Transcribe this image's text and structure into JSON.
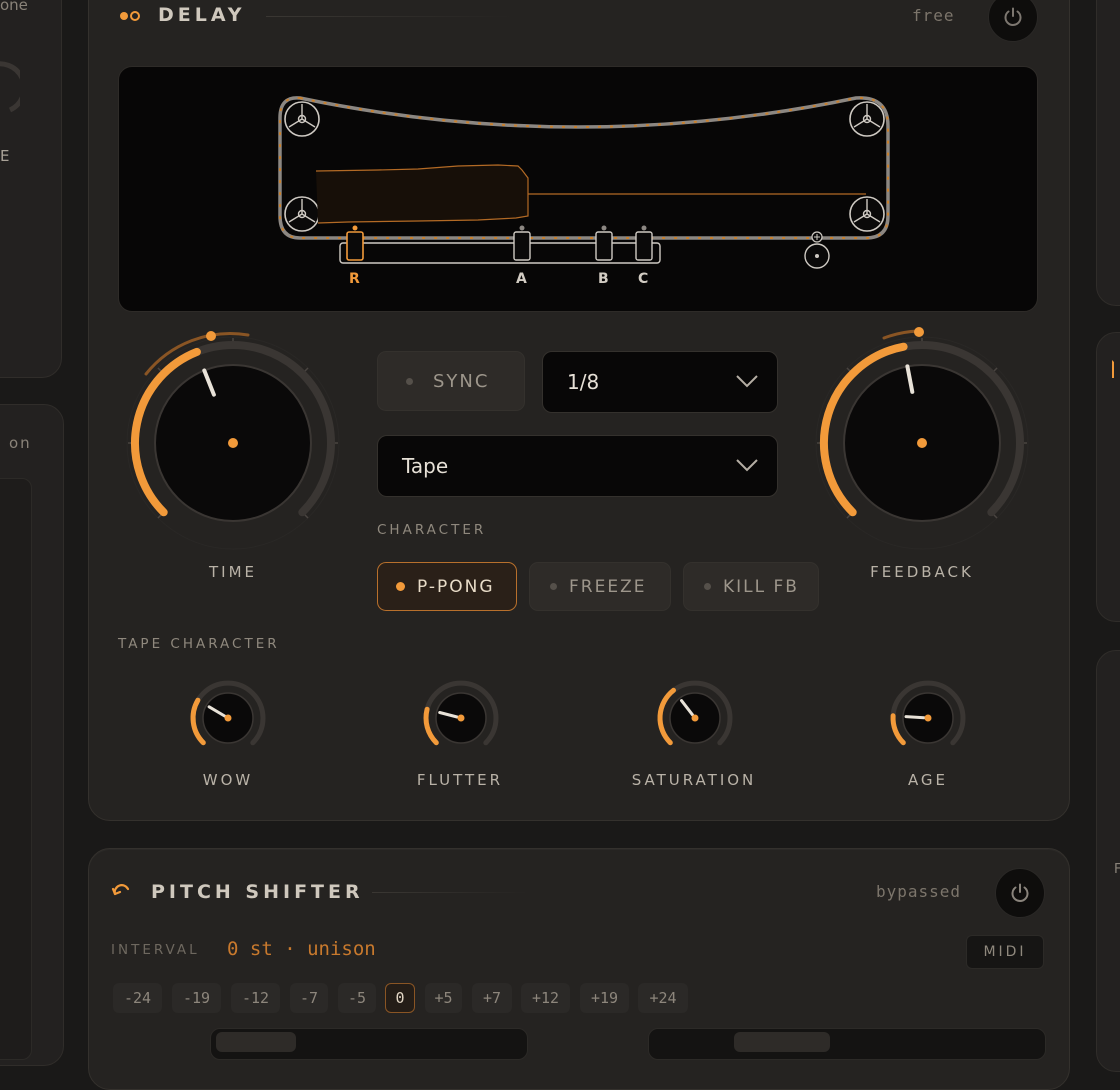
{
  "left_panel": {
    "top_text": "one",
    "mid_text": "E",
    "lower_text": "on"
  },
  "right_panel": {
    "mid_text": "F"
  },
  "delay": {
    "title": "DELAY",
    "status": "free",
    "tape_heads": [
      "R",
      "A",
      "B",
      "C"
    ],
    "time": {
      "label": "TIME",
      "value_fraction": 0.42
    },
    "feedback": {
      "label": "FEEDBACK",
      "value_fraction": 0.46
    },
    "sync": {
      "label": "SYNC",
      "active": false
    },
    "division": {
      "value": "1/8"
    },
    "mode": {
      "value": "Tape"
    },
    "character_label": "CHARACTER",
    "toggles": [
      {
        "label": "P-PONG",
        "active": true
      },
      {
        "label": "FREEZE",
        "active": false
      },
      {
        "label": "KILL FB",
        "active": false
      }
    ],
    "tape_character_label": "TAPE CHARACTER",
    "tape_knobs": [
      {
        "label": "WOW",
        "value_fraction": 0.28
      },
      {
        "label": "FLUTTER",
        "value_fraction": 0.22
      },
      {
        "label": "SATURATION",
        "value_fraction": 0.36
      },
      {
        "label": "AGE",
        "value_fraction": 0.18
      }
    ]
  },
  "pitch_shifter": {
    "title": "PITCH SHIFTER",
    "status": "bypassed",
    "interval_label": "INTERVAL",
    "interval_value": "0 st · unison",
    "midi_label": "MIDI",
    "intervals": [
      "-24",
      "-19",
      "-12",
      "-7",
      "-5",
      "0",
      "+5",
      "+7",
      "+12",
      "+19",
      "+24"
    ],
    "selected_interval": "0"
  },
  "colors": {
    "accent": "#f29a3a",
    "bg": "#1a1918",
    "panel": "#252321"
  }
}
